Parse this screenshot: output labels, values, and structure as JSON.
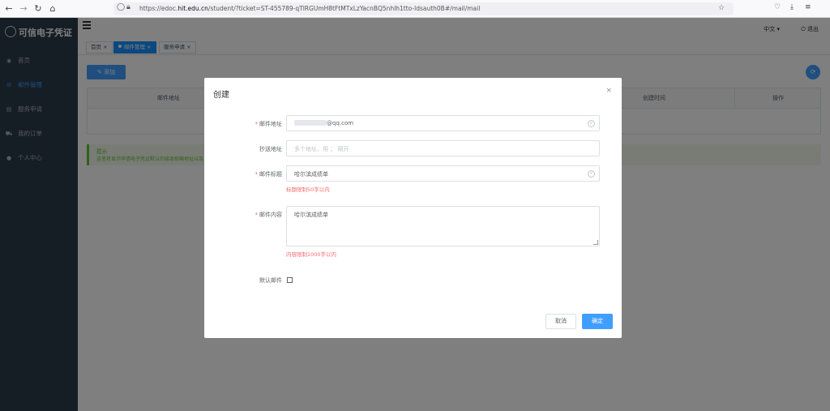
{
  "browser": {
    "url_prefix": "https://edoc.",
    "url_domain": "hit.edu.cn",
    "url_rest": "/student/?ticket=ST-455789-qTlRGUmH8tFtMTxLzYacnBQ5nhlh1tto-ldsauth0B#/mail/mail"
  },
  "sidebar": {
    "logo_text": "可信电子凭证",
    "items": [
      {
        "label": "首页",
        "icon": "dashboard-icon"
      },
      {
        "label": "邮件管理",
        "icon": "mail-icon"
      },
      {
        "label": "服务申请",
        "icon": "document-icon"
      },
      {
        "label": "我的订单",
        "icon": "cart-icon"
      },
      {
        "label": "个人中心",
        "icon": "user-icon"
      }
    ]
  },
  "header": {
    "language": "中文 ▾",
    "logout": "⏻ 退出"
  },
  "tags": [
    "首页 ×",
    "邮件管理 ×",
    "服务申请 ×"
  ],
  "main": {
    "add_button": "✎ 添加",
    "table_headers": [
      "邮件地址",
      "创建时间",
      "操作"
    ],
    "tip_title": "提示",
    "tip_text": "这里将显示申请电子凭证默认的接收邮箱地址以及"
  },
  "dialog": {
    "title": "创建",
    "close": "×",
    "fields": {
      "email_label": "邮件地址",
      "email_value": "@qq.com",
      "cc_label": "抄送地址",
      "cc_placeholder": "多个地址，用 ； 隔开",
      "subject_label": "邮件标题",
      "subject_value": "哈尔滨成绩单",
      "subject_hint": "标题限制50字以内",
      "content_label": "邮件内容",
      "content_value": "哈尔滨成绩单",
      "content_hint": "内容限制1000字以内",
      "default_label": "默认邮件"
    },
    "cancel": "取消",
    "confirm": "确定"
  },
  "colors": {
    "primary": "#409eff",
    "sidebar_bg": "#2b3a4a",
    "error": "#f56c6c",
    "success": "#67c23a"
  }
}
